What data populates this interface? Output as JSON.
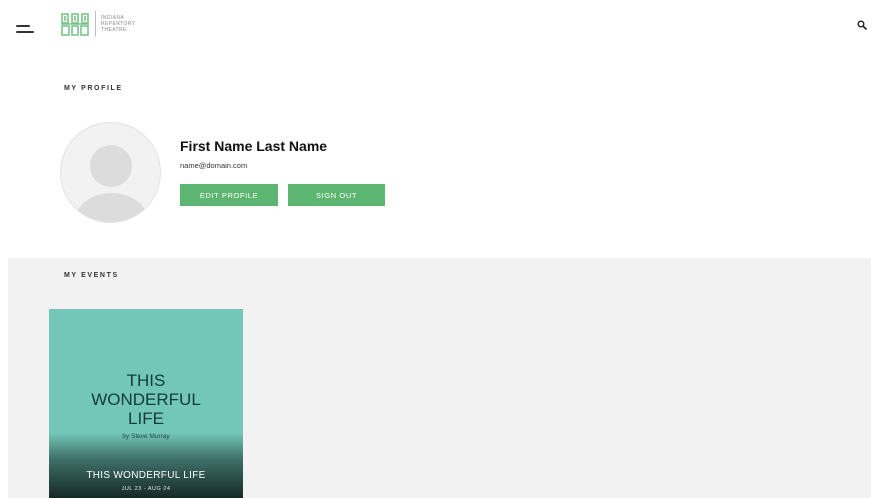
{
  "header": {
    "logo_lines": [
      "INDIANA",
      "REPERTORY",
      "THEATRE"
    ],
    "menu_icon": "hamburger-menu-icon",
    "search_icon": "search-icon",
    "brand_color": "#5cb672"
  },
  "profile": {
    "section_label": "MY PROFILE",
    "name": "First Name Last Name",
    "email": "name@domain.com",
    "edit_label": "EDIT PROFILE",
    "signout_label": "SIGN OUT"
  },
  "events": {
    "section_label": "MY EVENTS",
    "items": [
      {
        "poster_title_lines": [
          "THIS",
          "WONDERFUL",
          "LIFE"
        ],
        "byline": "by Steve Murray",
        "name": "THIS WONDERFUL LIFE",
        "dates": "JUL 23 - AUG 24",
        "poster_color": "#73c7b9"
      }
    ]
  }
}
